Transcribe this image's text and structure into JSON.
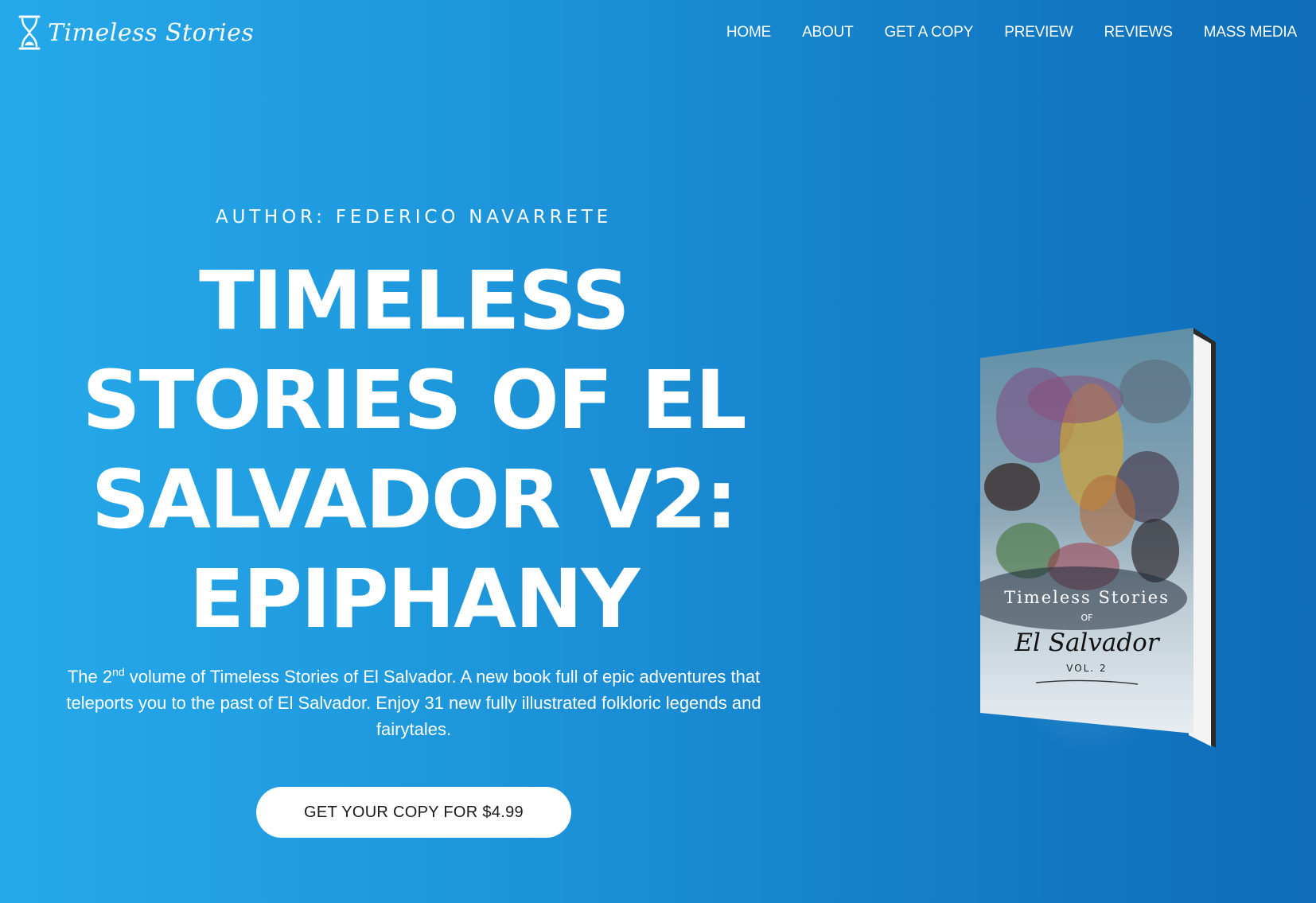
{
  "site": {
    "logo_text": "Timeless Stories"
  },
  "nav": {
    "items": [
      {
        "label": "HOME"
      },
      {
        "label": "ABOUT"
      },
      {
        "label": "GET A COPY"
      },
      {
        "label": "PREVIEW"
      },
      {
        "label": "REVIEWS"
      },
      {
        "label": "MASS MEDIA"
      }
    ]
  },
  "hero": {
    "author": "AUTHOR: FEDERICO NAVARRETE",
    "title": "TIMELESS STORIES OF EL SALVADOR V2: EPIPHANY",
    "desc_prefix": "The 2",
    "desc_sup": "nd",
    "desc_rest": " volume of Timeless Stories of El Salvador. A new book full of epic adventures that teleports you to the past of El Salvador. Enjoy 31 new fully illustrated folkloric legends and fairytales.",
    "cta_label": "GET YOUR COPY FOR $4.99"
  },
  "book": {
    "cover_line1": "Timeless Stories",
    "cover_line2": "OF",
    "cover_line3": "El Salvador",
    "cover_line4": "VOL. 2"
  },
  "colors": {
    "bg_left": "#25a9ea",
    "bg_right": "#0e6cb8",
    "text": "#ffffff",
    "cta_bg": "#ffffff",
    "cta_text": "#1a1a1a"
  }
}
